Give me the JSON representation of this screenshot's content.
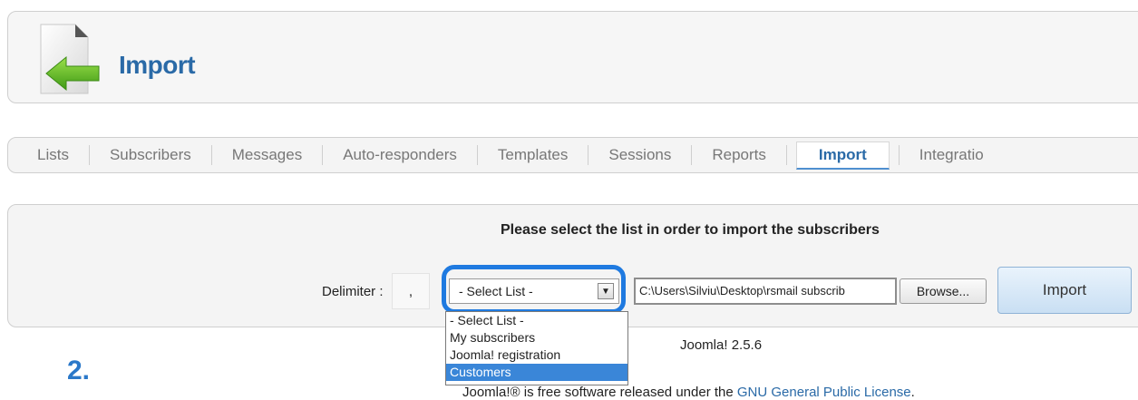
{
  "header": {
    "title": "Import",
    "icon": "import-page-icon"
  },
  "tabs": [
    {
      "label": "Lists",
      "active": false
    },
    {
      "label": "Subscribers",
      "active": false
    },
    {
      "label": "Messages",
      "active": false
    },
    {
      "label": "Auto-responders",
      "active": false
    },
    {
      "label": "Templates",
      "active": false
    },
    {
      "label": "Sessions",
      "active": false
    },
    {
      "label": "Reports",
      "active": false
    },
    {
      "label": "Import",
      "active": true
    },
    {
      "label": "Integratio",
      "active": false
    }
  ],
  "import_form": {
    "heading": "Please select the list in order to import the subscribers",
    "delimiter_label": "Delimiter :",
    "delimiter_value": ",",
    "select_value": "- Select List -",
    "file_path": "C:\\Users\\Silviu\\Desktop\\rsmail subscrib",
    "browse_label": "Browse...",
    "import_label": "Import"
  },
  "dropdown": {
    "options": [
      "- Select List -",
      "My subscribers",
      "Joomla! registration",
      "Customers"
    ],
    "highlighted": "Customers"
  },
  "footer": {
    "version": "Joomla! 2.5.6",
    "license_prefix": "Joomla!® is free software released under the ",
    "license_link": "GNU General Public License",
    "license_suffix": "."
  },
  "annotation": {
    "step": "2."
  },
  "colors": {
    "title_blue": "#2a6aa7",
    "highlight_blue": "#1f7ae0",
    "option_selected": "#3a86d8"
  }
}
